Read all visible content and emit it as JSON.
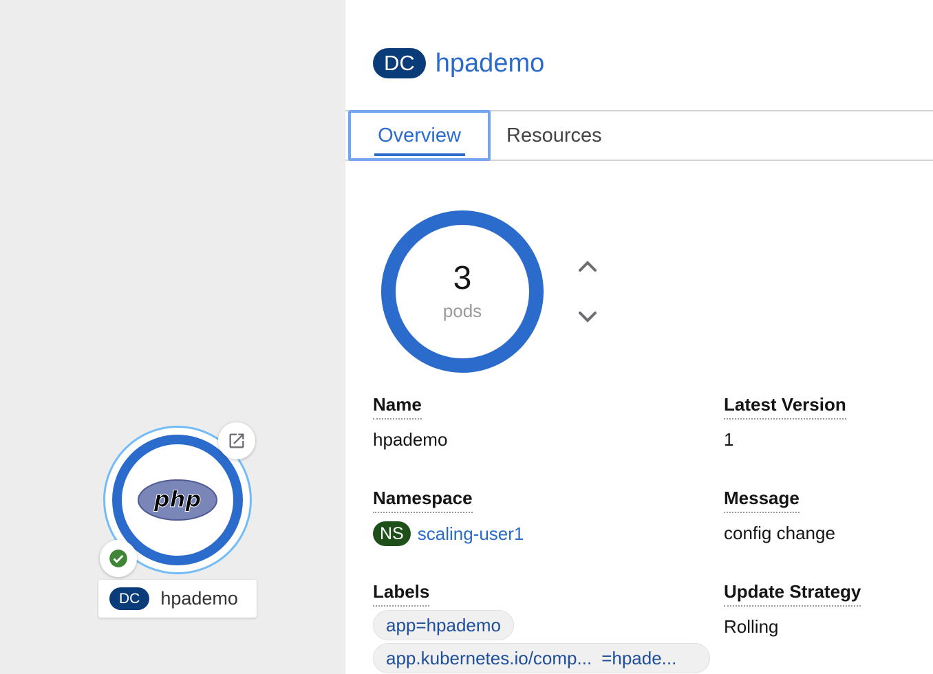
{
  "topology": {
    "node": {
      "runtime_icon": "php-logo",
      "logo_text": "php",
      "kind_badge": "DC",
      "name": "hpademo",
      "status": "ok"
    }
  },
  "panel": {
    "kind_badge": "DC",
    "resource_name": "hpademo",
    "tabs": [
      {
        "label": "Overview",
        "active": true
      },
      {
        "label": "Resources",
        "active": false
      }
    ],
    "pods": {
      "count": "3",
      "label": "pods"
    },
    "fields": {
      "name": {
        "label": "Name",
        "value": "hpademo"
      },
      "latest_version": {
        "label": "Latest Version",
        "value": "1"
      },
      "namespace": {
        "label": "Namespace",
        "badge": "NS",
        "value": "scaling-user1"
      },
      "message": {
        "label": "Message",
        "value": "config change"
      },
      "labels": {
        "label": "Labels",
        "chips": [
          "app=hpademo"
        ],
        "chip2_key": "app.kubernetes.io/comp...",
        "chip2_value": "=hpade..."
      },
      "update_strategy": {
        "label": "Update Strategy",
        "value": "Rolling"
      }
    }
  },
  "colors": {
    "accent": "#2b6bcb",
    "badge_dc": "#0b3c7a",
    "badge_ns": "#1e4f18",
    "status_ok": "#3e8635",
    "canvas_bg": "#ededed"
  }
}
